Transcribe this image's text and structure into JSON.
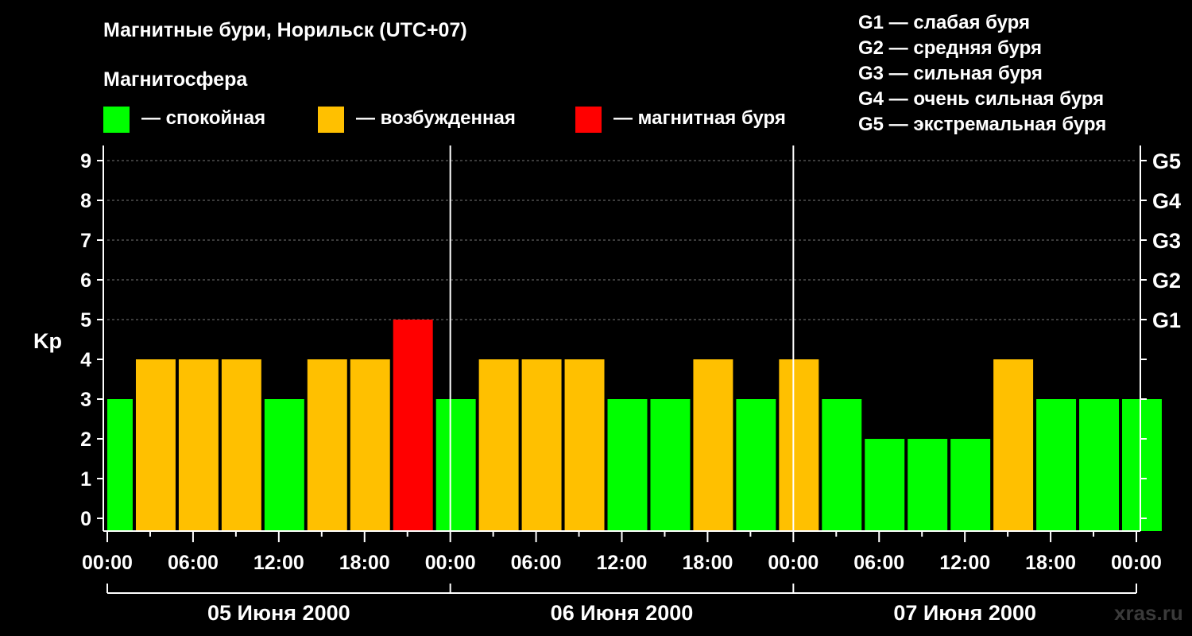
{
  "title": "Магнитные бури, Норильск (UTC+07)",
  "legend": {
    "heading": "Магнитосфера",
    "items": [
      {
        "label": "— спокойная",
        "color": "#00ff00"
      },
      {
        "label": "— возбужденная",
        "color": "#ffc000"
      },
      {
        "label": "— магнитная буря",
        "color": "#ff0000"
      }
    ]
  },
  "g_scale": [
    "G1 — слабая буря",
    "G2 — средняя буря",
    "G3 — сильная буря",
    "G4 — очень сильная буря",
    "G5 — экстремальная буря"
  ],
  "site": "xras.ru",
  "chart_data": {
    "type": "bar",
    "ylabel": "Kp",
    "ylim": [
      0,
      9
    ],
    "y_ticks": [
      "0",
      "1",
      "2",
      "3",
      "4",
      "5",
      "6",
      "7",
      "8",
      "9"
    ],
    "right_ticks": [
      {
        "y": 5,
        "label": "G1"
      },
      {
        "y": 6,
        "label": "G2"
      },
      {
        "y": 7,
        "label": "G3"
      },
      {
        "y": 8,
        "label": "G4"
      },
      {
        "y": 9,
        "label": "G5"
      }
    ],
    "x_ticks": [
      "00:00",
      "06:00",
      "12:00",
      "18:00",
      "00:00",
      "06:00",
      "12:00",
      "18:00",
      "00:00",
      "06:00",
      "12:00",
      "18:00",
      "00:00"
    ],
    "days": [
      "05 Июня 2000",
      "06 Июня 2000",
      "07 Июня 2000"
    ],
    "grid": "dashed horizontal",
    "bars": [
      {
        "start": -1,
        "end": 2,
        "kp": 3,
        "status": "quiet"
      },
      {
        "start": 2,
        "end": 5,
        "kp": 4,
        "status": "active"
      },
      {
        "start": 5,
        "end": 8,
        "kp": 4,
        "status": "active"
      },
      {
        "start": 8,
        "end": 11,
        "kp": 4,
        "status": "active"
      },
      {
        "start": 11,
        "end": 14,
        "kp": 3,
        "status": "quiet"
      },
      {
        "start": 14,
        "end": 17,
        "kp": 4,
        "status": "active"
      },
      {
        "start": 17,
        "end": 20,
        "kp": 4,
        "status": "active"
      },
      {
        "start": 20,
        "end": 23,
        "kp": 5,
        "status": "storm"
      },
      {
        "start": 23,
        "end": 26,
        "kp": 3,
        "status": "quiet"
      },
      {
        "start": 26,
        "end": 29,
        "kp": 4,
        "status": "active"
      },
      {
        "start": 29,
        "end": 32,
        "kp": 4,
        "status": "active"
      },
      {
        "start": 32,
        "end": 35,
        "kp": 4,
        "status": "active"
      },
      {
        "start": 35,
        "end": 38,
        "kp": 3,
        "status": "quiet"
      },
      {
        "start": 38,
        "end": 41,
        "kp": 3,
        "status": "quiet"
      },
      {
        "start": 41,
        "end": 44,
        "kp": 4,
        "status": "active"
      },
      {
        "start": 44,
        "end": 47,
        "kp": 3,
        "status": "quiet"
      },
      {
        "start": 47,
        "end": 50,
        "kp": 4,
        "status": "active"
      },
      {
        "start": 50,
        "end": 53,
        "kp": 3,
        "status": "quiet"
      },
      {
        "start": 53,
        "end": 56,
        "kp": 2,
        "status": "quiet"
      },
      {
        "start": 56,
        "end": 59,
        "kp": 2,
        "status": "quiet"
      },
      {
        "start": 59,
        "end": 62,
        "kp": 2,
        "status": "quiet"
      },
      {
        "start": 62,
        "end": 65,
        "kp": 4,
        "status": "active"
      },
      {
        "start": 65,
        "end": 68,
        "kp": 3,
        "status": "quiet"
      },
      {
        "start": 68,
        "end": 71,
        "kp": 3,
        "status": "quiet"
      },
      {
        "start": 71,
        "end": 74,
        "kp": 3,
        "status": "quiet"
      }
    ],
    "status_colors": {
      "quiet": "#00ff00",
      "active": "#ffc000",
      "storm": "#ff0000"
    }
  }
}
